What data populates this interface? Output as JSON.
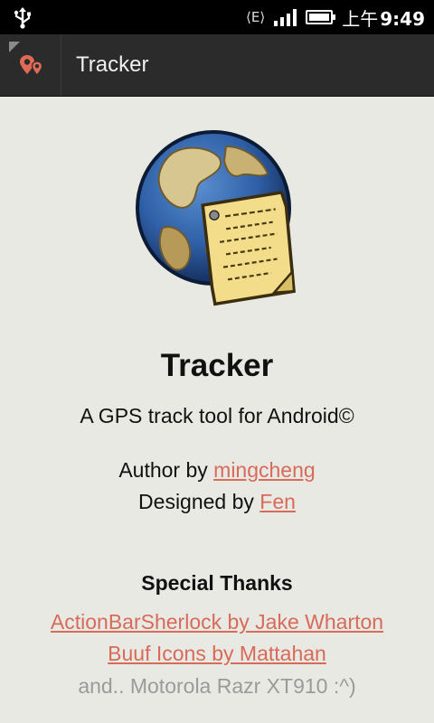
{
  "status_bar": {
    "network": "E",
    "time_prefix": "上午",
    "time": "9:49",
    "icons": [
      "usb-icon",
      "network-e-icon",
      "signal-icon",
      "battery-icon"
    ]
  },
  "action_bar": {
    "title": "Tracker",
    "icon": "map-pins-icon",
    "background": "#2b2b2b"
  },
  "about": {
    "app_name": "Tracker",
    "tagline": "A GPS track tool for Android©",
    "author_prefix": "Author by ",
    "author_link": "mingcheng",
    "designer_prefix": "Designed by ",
    "designer_link": "Fen",
    "thanks_title": "Special Thanks",
    "thanks_links": [
      "ActionBarSherlock by Jake Wharton",
      "Buuf Icons by Mattahan"
    ],
    "thanks_extra": "and.. Motorola Razr XT910 :^)"
  },
  "colors": {
    "link": "#d86a5a",
    "background": "#e9e9e4",
    "muted_text": "#9a9a9a"
  }
}
